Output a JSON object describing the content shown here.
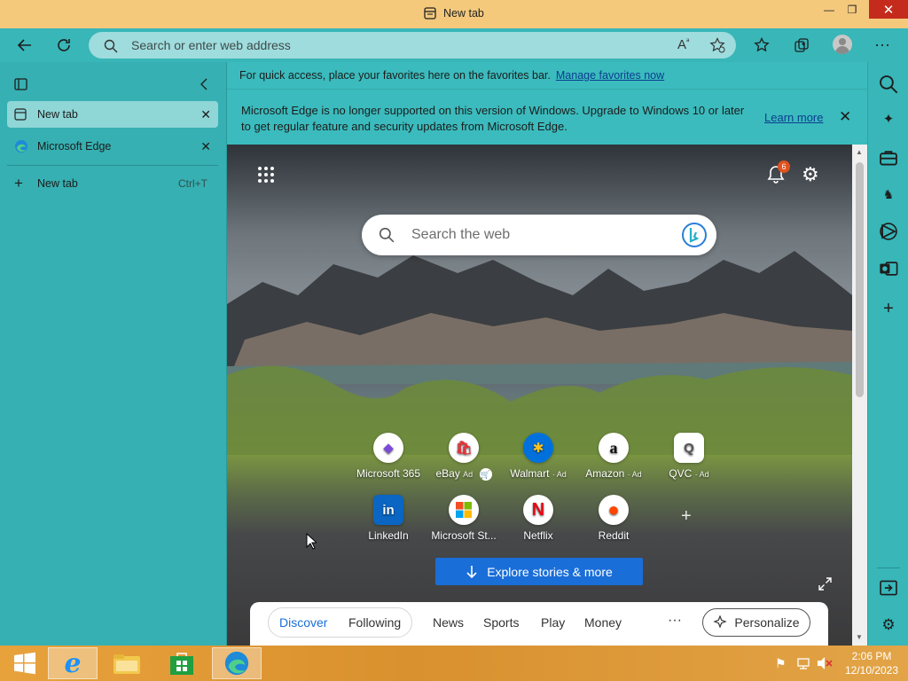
{
  "window": {
    "title": "New tab",
    "minimize": "—",
    "maximize": "❐",
    "close": "✕"
  },
  "toolbar": {
    "address_placeholder": "Search or enter web address"
  },
  "vertical_tabs": {
    "tabs": [
      {
        "label": "New tab",
        "close": "✕"
      },
      {
        "label": "Microsoft Edge",
        "close": "✕"
      }
    ],
    "new_tab_label": "New tab",
    "new_tab_shortcut": "Ctrl+T"
  },
  "favorites_bar": {
    "text": "For quick access, place your favorites here on the favorites bar.",
    "link": "Manage favorites now"
  },
  "infobar": {
    "message": "Microsoft Edge is no longer supported on this version of Windows. Upgrade to Windows 10 or later to get regular feature and security updates from Microsoft Edge.",
    "learn_more": "Learn more",
    "close": "✕"
  },
  "newtab": {
    "search_placeholder": "Search the web",
    "notification_count": "6",
    "tiles_row1": [
      {
        "label": "Microsoft 365",
        "ad": "",
        "glyph": "◆",
        "color": "#7b4bd8"
      },
      {
        "label": "eBay",
        "ad": "Ad",
        "glyph": "🛍",
        "color": "#e53238"
      },
      {
        "label": "Walmart",
        "ad": "· Ad",
        "glyph": "✱",
        "color": "#0071dc"
      },
      {
        "label": "Amazon",
        "ad": "· Ad",
        "glyph": "a",
        "color": "#111111"
      },
      {
        "label": "QVC",
        "ad": "· Ad",
        "glyph": "Q",
        "color": "#555555"
      }
    ],
    "tiles_row2": [
      {
        "label": "LinkedIn",
        "glyph": "in",
        "color": "#0a66c2"
      },
      {
        "label": "Microsoft St...",
        "glyph": "▦",
        "color": "#f25022"
      },
      {
        "label": "Netflix",
        "glyph": "N",
        "color": "#e50914"
      },
      {
        "label": "Reddit",
        "glyph": "●",
        "color": "#ff4500"
      }
    ],
    "add_tile": "+",
    "explore_button": "Explore stories & more",
    "feed_tabs": [
      "Discover",
      "Following",
      "News",
      "Sports",
      "Play",
      "Money"
    ],
    "more": "···",
    "personalize": "Personalize"
  },
  "taskbar": {
    "time": "2:06 PM",
    "date": "12/10/2023"
  },
  "colors": {
    "accent": "#1a6ed8",
    "titlebar": "#f4c97c",
    "toolbar": "#38b6b8",
    "close_red": "#c42b1c"
  }
}
